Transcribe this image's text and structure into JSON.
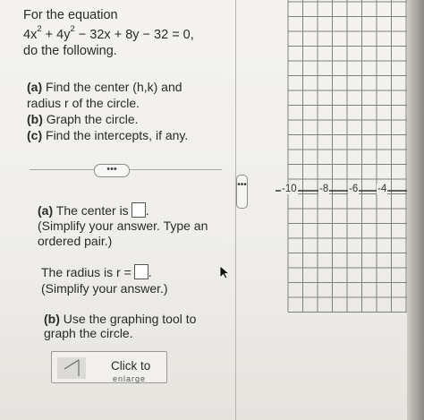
{
  "problem": {
    "intro": "For the equation",
    "eq_parts": [
      "4x",
      "2",
      " + 4y",
      "2",
      " − 32x + 8y − 32 = 0,"
    ],
    "instruction": "do the following."
  },
  "parts": [
    {
      "label": "(a)",
      "line1": " Find the center (h,k) and",
      "line2": "radius r of the circle."
    },
    {
      "label": "(b)",
      "line1": " Graph the circle."
    },
    {
      "label": "(c)",
      "line1": " Find the intercepts, if any."
    }
  ],
  "more_button": "•••",
  "scroll_handle": "•••",
  "answer": {
    "center_label": "(a)",
    "center_text": " The center is",
    "center_value": "",
    "center_period": ".",
    "center_hint1": "(Simplify your answer. Type an",
    "center_hint2": "ordered pair.)",
    "radius_text": "The radius is r =",
    "radius_value": "",
    "radius_period": ".",
    "radius_hint": "(Simplify your answer.)",
    "graph_label": "(b)",
    "graph_line1": " Use the graphing tool to",
    "graph_line2": "graph the circle.",
    "click_label": "Click to",
    "click_label2": "enlarge"
  },
  "graph": {
    "x_tick_labels": [
      "-10",
      "-8",
      "-6",
      "-4"
    ],
    "icon": "line-tool-icon"
  },
  "colors": {
    "accent": "#1f4fa0",
    "grid": "#7b7b7b"
  }
}
